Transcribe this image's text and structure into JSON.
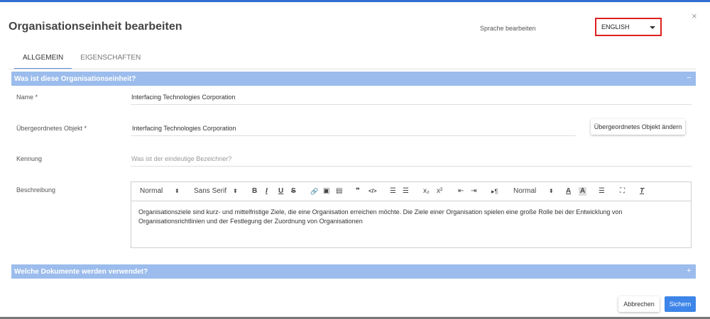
{
  "dialog": {
    "title": "Organisationseinheit bearbeiten",
    "close_glyph": "×",
    "language_label": "Sprache bearbeiten",
    "language_value": "ENGLISH"
  },
  "tabs": [
    {
      "label": "ALLGEMEIN",
      "active": true
    },
    {
      "label": "EIGENSCHAFTEN",
      "active": false
    }
  ],
  "section_general": {
    "title": "Was ist diese Organisationseinheit?",
    "toggle": "−"
  },
  "fields": {
    "name": {
      "label": "Name *",
      "value": "Interfacing Technologies Corporation"
    },
    "parent": {
      "label": "Übergeordnetes Objekt *",
      "value": "Interfacing Technologies Corporation",
      "change_button": "Übergeordnetes Objekt ändern"
    },
    "identifier": {
      "label": "Kennung",
      "placeholder": "Was ist der eindeutige Bezeichner?"
    },
    "description": {
      "label": "Beschreibung"
    }
  },
  "editor": {
    "toolbar": {
      "header_select": "Normal",
      "font_select": "Sans Serif",
      "size_select": "Normal",
      "select_arrow": "⬍",
      "bold": "B",
      "italic": "I",
      "underline": "U",
      "strike": "S",
      "link": "🔗",
      "image": "▣",
      "video": "▤",
      "blockquote": "❞",
      "code": "</>",
      "ordered_list": "☰",
      "bullet_list": "☰",
      "subscript": "x₂",
      "superscript": "x²",
      "outdent": "⇤",
      "indent": "⇥",
      "direction": "▸¶",
      "text_color": "A",
      "background_color": "A",
      "align": "☰",
      "fullscreen": "⛶",
      "clean": "T"
    },
    "content": "Organisationsziele sind kurz- und mittelfristige Ziele, die eine Organisation erreichen möchte. Die Ziele einer Organisation spielen eine große Rolle bei der Entwicklung von Organisationsrichtlinien und der Festlegung der Zuordnung von Organisationen"
  },
  "section_documents": {
    "title": "Welche Dokumente werden verwendet?",
    "toggle": "+"
  },
  "footer": {
    "cancel": "Abbrechen",
    "save": "Sichern"
  },
  "colors": {
    "section_bar": "#9bbcec",
    "primary": "#3d85e8",
    "highlight_border": "#e02020"
  }
}
